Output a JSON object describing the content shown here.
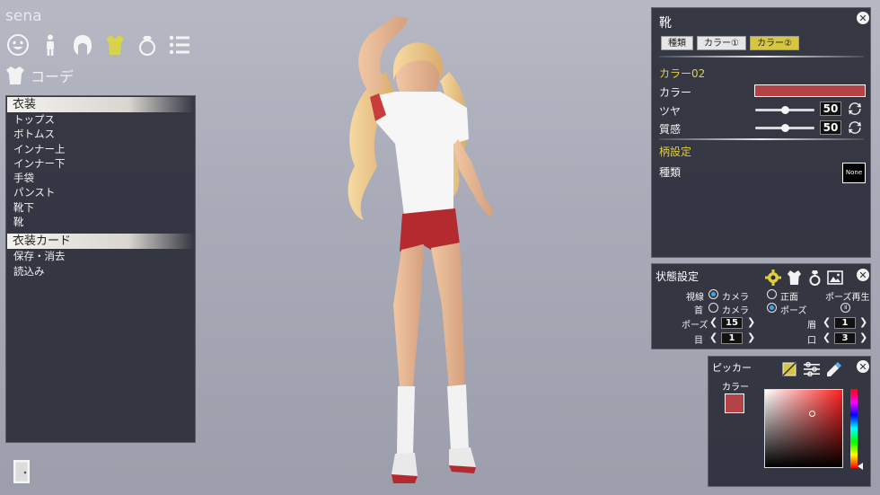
{
  "character_name": "sena",
  "coord_label": "コーデ",
  "category_icons": [
    "face-icon",
    "body-icon",
    "hair-icon",
    "clothes-icon",
    "accessory-icon",
    "settings-list-icon"
  ],
  "menu": {
    "section1": "衣装",
    "items1": [
      "トップス",
      "ボトムス",
      "インナー上",
      "インナー下",
      "手袋",
      "パンスト",
      "靴下",
      "靴"
    ],
    "section2": "衣装カード",
    "items2": [
      "保存・消去",
      "読込み"
    ]
  },
  "shoes_panel": {
    "title": "靴",
    "tabs": [
      "種類",
      "カラー①",
      "カラー②"
    ],
    "active_tab": 2,
    "section_color": "カラー02",
    "color_label": "カラー",
    "color_value": "#b44347",
    "gloss_label": "ツヤ",
    "gloss_value": "50",
    "texture_label": "質感",
    "texture_value": "50",
    "pattern_section": "柄設定",
    "pattern_type_label": "種類",
    "pattern_value": "None"
  },
  "state_panel": {
    "title": "状態設定",
    "gaze_label": "視線",
    "neck_label": "首",
    "camera_label": "カメラ",
    "front_label": "正面",
    "pose_opt_label": "ポーズ",
    "pose_play_label": "ポーズ再生",
    "pose_label": "ポーズ",
    "pose_value": "15",
    "eyebrow_label": "眉",
    "eyebrow_value": "1",
    "eye_label": "目",
    "eye_value": "1",
    "mouth_label": "口",
    "mouth_value": "3"
  },
  "picker_panel": {
    "title": "ピッカー",
    "color_label": "カラー",
    "color_value": "#b44347"
  }
}
